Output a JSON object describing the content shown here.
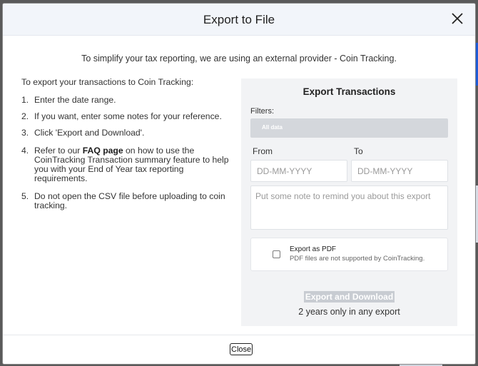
{
  "dialog": {
    "title": "Export to File",
    "intro": "To simplify your tax reporting, we are using an external provider - Coin Tracking.",
    "close_icon": "close-icon"
  },
  "instructions": {
    "lead": "To export your transactions to Coin Tracking:",
    "steps": [
      {
        "num": "1.",
        "text": "Enter the date range."
      },
      {
        "num": "2.",
        "text": "If you want, enter some notes for your reference."
      },
      {
        "num": "3.",
        "text": "Click 'Export and Download'."
      },
      {
        "num": "4.",
        "pre": "Refer to our ",
        "link": "FAQ page",
        "post": " on how to use the CoinTracking Transaction summary feature to help you with your End of Year tax reporting requirements."
      },
      {
        "num": "5.",
        "text": "Do not open the CSV file before uploading to coin tracking."
      }
    ]
  },
  "panel": {
    "title": "Export Transactions",
    "filters_label": "Filters:",
    "filter_value": "All data",
    "from_label": "From",
    "to_label": "To",
    "from_placeholder": "DD-MM-YYYY",
    "to_placeholder": "DD-MM-YYYY",
    "note_placeholder": "Put some note to remind you about this export",
    "pdf_title": "Export as PDF",
    "pdf_note": "PDF files are not supported by CoinTracking.",
    "pdf_checked": false,
    "export_button": "Export and Download",
    "years_note": "2 years only in any export"
  },
  "footer": {
    "close_button": "Close"
  }
}
